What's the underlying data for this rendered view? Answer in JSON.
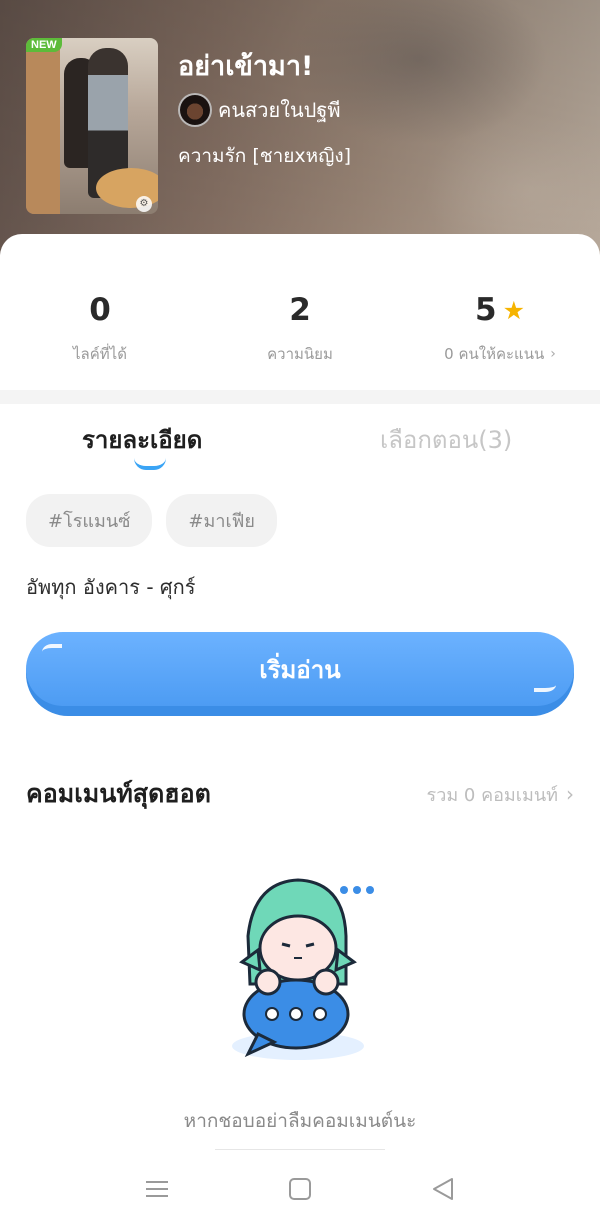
{
  "header": {
    "badge": "NEW",
    "title": "อย่าเข้ามา!",
    "author": "คนสวยในปฐพี",
    "genre": "ความรัก [ชายxหญิง]"
  },
  "stats": [
    {
      "value": "0",
      "label": "ไลค์ที่ได้"
    },
    {
      "value": "2",
      "label": "ความนิยม"
    },
    {
      "value": "5",
      "label": "0 คนให้คะแนน"
    }
  ],
  "tabs": {
    "detail": "รายละเอียด",
    "chapters": "เลือกตอน(3)"
  },
  "tags": [
    "#โรแมนซ์",
    "#มาเฟีย"
  ],
  "schedule": "อัพทุก อังคาร - ศุกร์",
  "read_button": "เริ่มอ่าน",
  "comments": {
    "title": "คอมเมนท์สุดฮอต",
    "total": "รวม 0 คอมเมนท์",
    "empty_text": "หากชอบอย่าลืมคอมเมนต์นะ"
  },
  "colors": {
    "accent": "#4d9cf3",
    "tab_indicator": "#3aa4f5",
    "star": "#f6b400",
    "badge_new": "#5dbb3a",
    "mascot_hair": "#6fd8b8"
  },
  "icons": [
    "star-icon",
    "chevron-right-icon",
    "menu-icon",
    "home-icon",
    "back-icon"
  ]
}
